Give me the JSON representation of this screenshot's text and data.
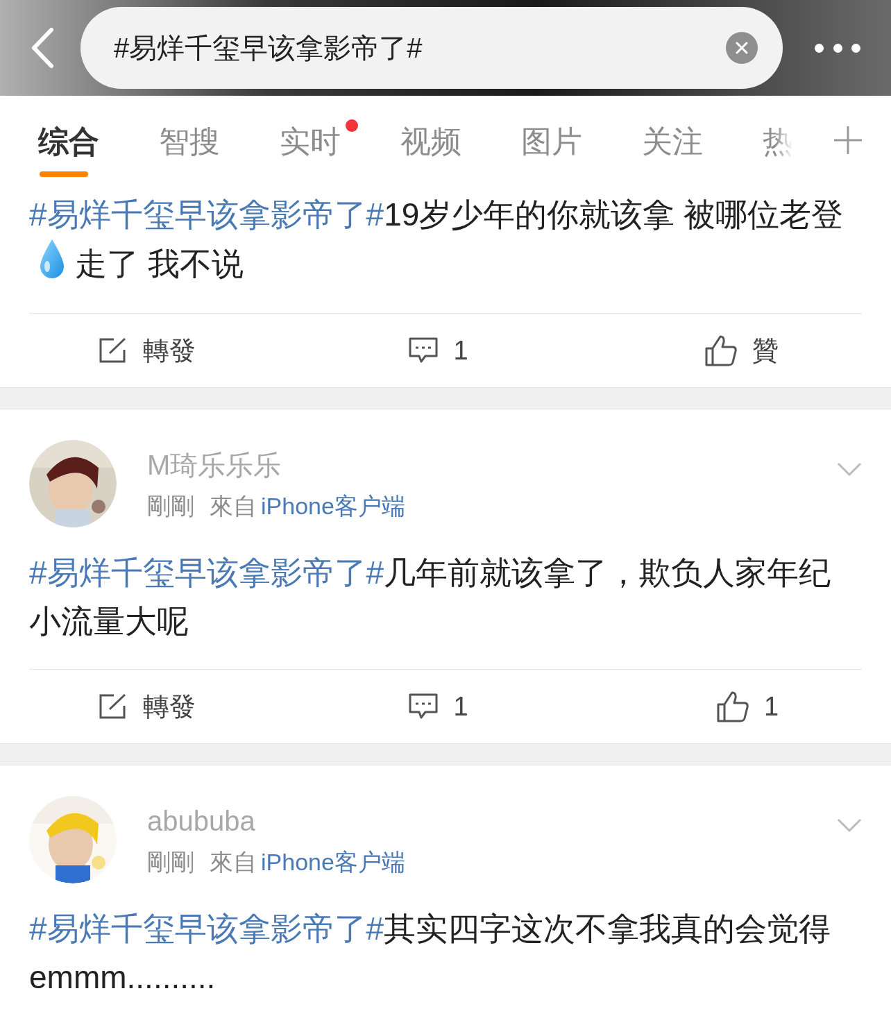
{
  "search_bar": {
    "query": "#易烊千玺早该拿影帝了#"
  },
  "tabs": [
    {
      "label": "综合",
      "selected": true,
      "dot": false
    },
    {
      "label": "智搜",
      "selected": false,
      "dot": false
    },
    {
      "label": "实时",
      "selected": false,
      "dot": true
    },
    {
      "label": "视频",
      "selected": false,
      "dot": false
    },
    {
      "label": "图片",
      "selected": false,
      "dot": false
    },
    {
      "label": "关注",
      "selected": false,
      "dot": false
    },
    {
      "label": "热",
      "selected": false,
      "dot": false
    }
  ],
  "posts": [
    {
      "hashtag": "#易烊千玺早该拿影帝了#",
      "segments": [
        {
          "kind": "text",
          "text": "19岁少年的你就该拿 被哪位老登"
        },
        {
          "kind": "emoji"
        },
        {
          "kind": "text",
          "text": "走了 我不说"
        }
      ],
      "repost": "轉發",
      "comments": "1",
      "like": "贊"
    },
    {
      "user": "M琦乐乐乐",
      "time": "剛剛",
      "from": "來自",
      "client": "iPhone客户端",
      "hashtag": "#易烊千玺早该拿影帝了#",
      "segments": [
        {
          "kind": "text",
          "text": "几年前就该拿了，欺负人家年纪小流量大呢"
        }
      ],
      "repost": "轉發",
      "comments": "1",
      "like": "1"
    },
    {
      "user": "abububa",
      "time": "剛剛",
      "from": "來自",
      "client": "iPhone客户端",
      "hashtag": "#易烊千玺早该拿影帝了#",
      "segments": [
        {
          "kind": "text",
          "text": "其实四字这次不拿我真的会觉得emmm.........."
        }
      ]
    }
  ]
}
